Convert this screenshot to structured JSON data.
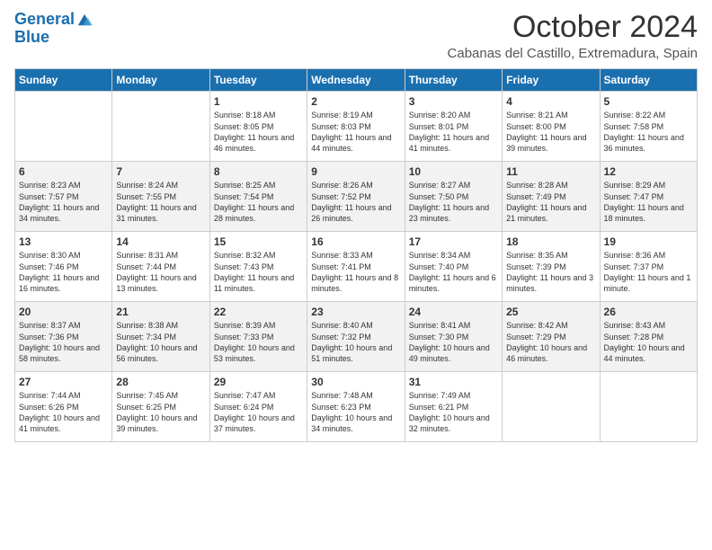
{
  "logo": {
    "line1": "General",
    "line2": "Blue"
  },
  "header": {
    "month": "October 2024",
    "location": "Cabanas del Castillo, Extremadura, Spain"
  },
  "days_of_week": [
    "Sunday",
    "Monday",
    "Tuesday",
    "Wednesday",
    "Thursday",
    "Friday",
    "Saturday"
  ],
  "weeks": [
    [
      {
        "day": "",
        "info": ""
      },
      {
        "day": "",
        "info": ""
      },
      {
        "day": "1",
        "info": "Sunrise: 8:18 AM\nSunset: 8:05 PM\nDaylight: 11 hours and 46 minutes."
      },
      {
        "day": "2",
        "info": "Sunrise: 8:19 AM\nSunset: 8:03 PM\nDaylight: 11 hours and 44 minutes."
      },
      {
        "day": "3",
        "info": "Sunrise: 8:20 AM\nSunset: 8:01 PM\nDaylight: 11 hours and 41 minutes."
      },
      {
        "day": "4",
        "info": "Sunrise: 8:21 AM\nSunset: 8:00 PM\nDaylight: 11 hours and 39 minutes."
      },
      {
        "day": "5",
        "info": "Sunrise: 8:22 AM\nSunset: 7:58 PM\nDaylight: 11 hours and 36 minutes."
      }
    ],
    [
      {
        "day": "6",
        "info": "Sunrise: 8:23 AM\nSunset: 7:57 PM\nDaylight: 11 hours and 34 minutes."
      },
      {
        "day": "7",
        "info": "Sunrise: 8:24 AM\nSunset: 7:55 PM\nDaylight: 11 hours and 31 minutes."
      },
      {
        "day": "8",
        "info": "Sunrise: 8:25 AM\nSunset: 7:54 PM\nDaylight: 11 hours and 28 minutes."
      },
      {
        "day": "9",
        "info": "Sunrise: 8:26 AM\nSunset: 7:52 PM\nDaylight: 11 hours and 26 minutes."
      },
      {
        "day": "10",
        "info": "Sunrise: 8:27 AM\nSunset: 7:50 PM\nDaylight: 11 hours and 23 minutes."
      },
      {
        "day": "11",
        "info": "Sunrise: 8:28 AM\nSunset: 7:49 PM\nDaylight: 11 hours and 21 minutes."
      },
      {
        "day": "12",
        "info": "Sunrise: 8:29 AM\nSunset: 7:47 PM\nDaylight: 11 hours and 18 minutes."
      }
    ],
    [
      {
        "day": "13",
        "info": "Sunrise: 8:30 AM\nSunset: 7:46 PM\nDaylight: 11 hours and 16 minutes."
      },
      {
        "day": "14",
        "info": "Sunrise: 8:31 AM\nSunset: 7:44 PM\nDaylight: 11 hours and 13 minutes."
      },
      {
        "day": "15",
        "info": "Sunrise: 8:32 AM\nSunset: 7:43 PM\nDaylight: 11 hours and 11 minutes."
      },
      {
        "day": "16",
        "info": "Sunrise: 8:33 AM\nSunset: 7:41 PM\nDaylight: 11 hours and 8 minutes."
      },
      {
        "day": "17",
        "info": "Sunrise: 8:34 AM\nSunset: 7:40 PM\nDaylight: 11 hours and 6 minutes."
      },
      {
        "day": "18",
        "info": "Sunrise: 8:35 AM\nSunset: 7:39 PM\nDaylight: 11 hours and 3 minutes."
      },
      {
        "day": "19",
        "info": "Sunrise: 8:36 AM\nSunset: 7:37 PM\nDaylight: 11 hours and 1 minute."
      }
    ],
    [
      {
        "day": "20",
        "info": "Sunrise: 8:37 AM\nSunset: 7:36 PM\nDaylight: 10 hours and 58 minutes."
      },
      {
        "day": "21",
        "info": "Sunrise: 8:38 AM\nSunset: 7:34 PM\nDaylight: 10 hours and 56 minutes."
      },
      {
        "day": "22",
        "info": "Sunrise: 8:39 AM\nSunset: 7:33 PM\nDaylight: 10 hours and 53 minutes."
      },
      {
        "day": "23",
        "info": "Sunrise: 8:40 AM\nSunset: 7:32 PM\nDaylight: 10 hours and 51 minutes."
      },
      {
        "day": "24",
        "info": "Sunrise: 8:41 AM\nSunset: 7:30 PM\nDaylight: 10 hours and 49 minutes."
      },
      {
        "day": "25",
        "info": "Sunrise: 8:42 AM\nSunset: 7:29 PM\nDaylight: 10 hours and 46 minutes."
      },
      {
        "day": "26",
        "info": "Sunrise: 8:43 AM\nSunset: 7:28 PM\nDaylight: 10 hours and 44 minutes."
      }
    ],
    [
      {
        "day": "27",
        "info": "Sunrise: 7:44 AM\nSunset: 6:26 PM\nDaylight: 10 hours and 41 minutes."
      },
      {
        "day": "28",
        "info": "Sunrise: 7:45 AM\nSunset: 6:25 PM\nDaylight: 10 hours and 39 minutes."
      },
      {
        "day": "29",
        "info": "Sunrise: 7:47 AM\nSunset: 6:24 PM\nDaylight: 10 hours and 37 minutes."
      },
      {
        "day": "30",
        "info": "Sunrise: 7:48 AM\nSunset: 6:23 PM\nDaylight: 10 hours and 34 minutes."
      },
      {
        "day": "31",
        "info": "Sunrise: 7:49 AM\nSunset: 6:21 PM\nDaylight: 10 hours and 32 minutes."
      },
      {
        "day": "",
        "info": ""
      },
      {
        "day": "",
        "info": ""
      }
    ]
  ]
}
